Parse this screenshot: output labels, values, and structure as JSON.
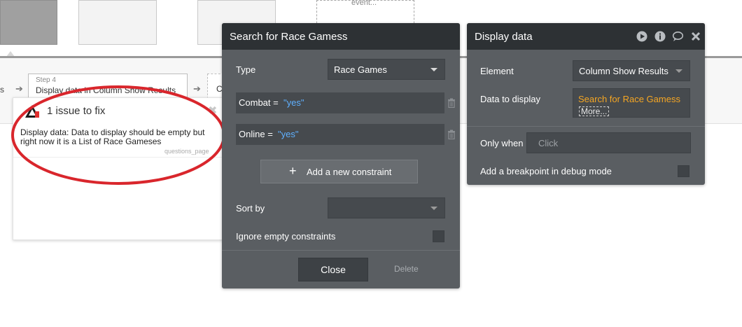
{
  "canvas": {
    "event_label": "event...",
    "step_prev_fragment": "s",
    "step4": {
      "number": "Step 4",
      "title": "Display data in Column Show Results"
    },
    "step_next_fragment": "C"
  },
  "issues": {
    "title": "1 issue to fix",
    "message": "Display data: Data to display should be empty but right now it is a List of Race Gameses",
    "page": "questions_page"
  },
  "search_panel": {
    "title": "Search for Race Gamess",
    "type_label": "Type",
    "type_value": "Race Games",
    "constraints": [
      {
        "field": "Combat =",
        "value": "\"yes\""
      },
      {
        "field": "Online =",
        "value": "\"yes\""
      }
    ],
    "add_constraint_label": "Add a new constraint",
    "sort_by_label": "Sort by",
    "sort_by_value": "",
    "ignore_empty_label": "Ignore empty constraints",
    "close_label": "Close",
    "delete_label": "Delete"
  },
  "display_panel": {
    "title": "Display data",
    "element_label": "Element",
    "element_value": "Column Show Results",
    "data_label": "Data to display",
    "data_value": "Search for Race Gamess",
    "more_label": "More...",
    "only_when_label": "Only when",
    "only_when_placeholder": "Click",
    "breakpoint_label": "Add a breakpoint in debug mode"
  },
  "colors": {
    "panel_bg": "#5a5e62",
    "panel_header": "#2d3134",
    "accent_orange": "#f5a623",
    "value_blue": "#5fb0ff",
    "annotation_red": "#d9262c"
  }
}
